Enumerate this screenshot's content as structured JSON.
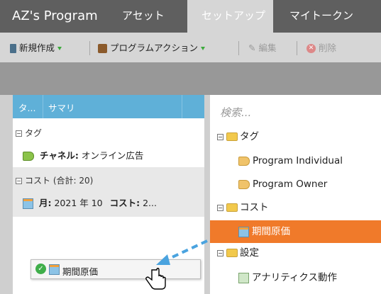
{
  "app": {
    "title": "AZ's Program"
  },
  "tabs": [
    {
      "label": "アセット"
    },
    {
      "label": "セットアップ"
    },
    {
      "label": "マイトークン"
    }
  ],
  "toolbar": {
    "new_label": "新規作成",
    "program_actions_label": "プログラムアクション",
    "edit_label": "編集",
    "delete_label": "削除"
  },
  "grid": {
    "col1": "タ...",
    "col2": "サマリ",
    "tag_group": "タグ",
    "tag_row_label": "チャネル:",
    "tag_row_value": "オンライン広告",
    "cost_group": "コスト (合計: 20)",
    "cost_row_month_label": "月:",
    "cost_row_month_value": "2021 年 10",
    "cost_row_cost_label": "コスト:",
    "cost_row_cost_value": "2..."
  },
  "tree": {
    "search_placeholder": "検索...",
    "tag_folder": "タグ",
    "program_individual": "Program Individual",
    "program_owner": "Program Owner",
    "cost_folder": "コスト",
    "period_cost": "期間原価",
    "settings_folder": "設定",
    "analytics_action": "アナリティクス動作"
  },
  "drag": {
    "label": "期間原価"
  },
  "colors": {
    "accent": "#f07a2a",
    "header_blue": "#5fb0d8"
  }
}
